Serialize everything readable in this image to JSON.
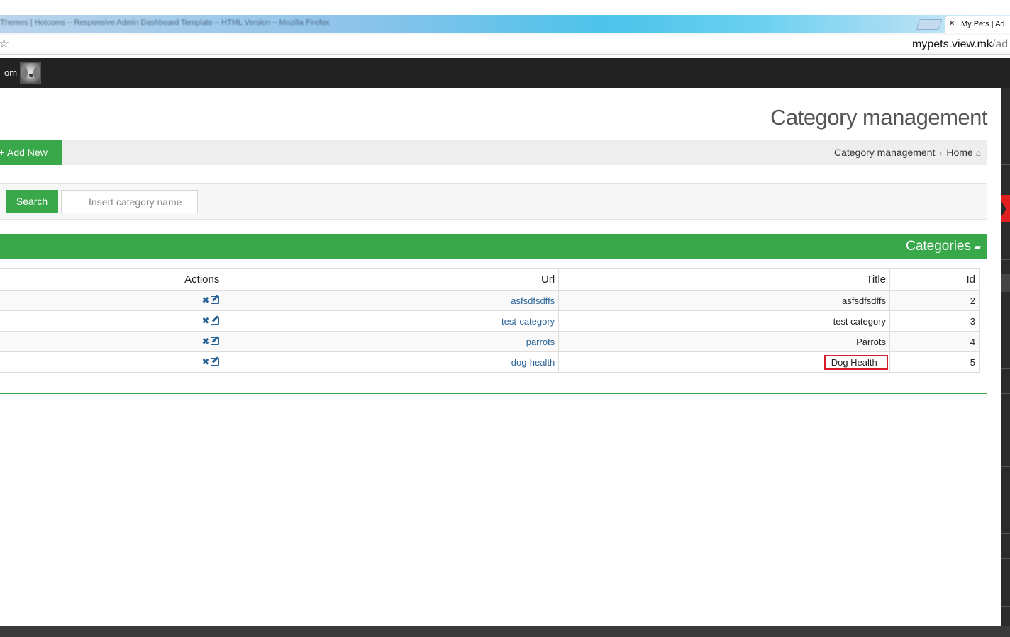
{
  "browser": {
    "window_title": "Themes | Hotcoms – Responsive Admin Dashboard Template – HTML Version – Mozilla Firefox",
    "tab_title": "My Pets | Ad",
    "tab_close": "×",
    "star_glyph": "☆",
    "url_host": "mypets.view.mk",
    "url_path": "/ad"
  },
  "navbar": {
    "user_text": "om",
    "avatar_icon": "dog-avatar"
  },
  "page": {
    "title": "Category management",
    "add_button": {
      "plus": "+",
      "label": "Add New"
    },
    "breadcrumb": {
      "current": "Category management",
      "separator": "‹",
      "home": "Home",
      "home_icon_glyph": "⌂"
    },
    "search": {
      "button_label": "Search",
      "placeholder": "Insert category name",
      "value": ""
    },
    "categories_panel": {
      "title": "Categories",
      "folder_icon_glyph": "▰",
      "columns": {
        "actions": "Actions",
        "url": "Url",
        "title": "Title",
        "id": "Id"
      },
      "rows": [
        {
          "url": "asfsdfsdffs",
          "title": "asfsdfsdffs",
          "id": "2"
        },
        {
          "url": "test-category",
          "title": "test category",
          "id": "3"
        },
        {
          "url": "parrots",
          "title": "Parrots",
          "id": "4"
        },
        {
          "url": "dog-health",
          "title": "Dog Health --",
          "id": "5"
        }
      ],
      "delete_glyph": "✖"
    }
  },
  "colors": {
    "primary_green": "#39a84a",
    "navbar_dark": "#222222",
    "link_blue": "#2a6496",
    "highlight_red": "#d41f2b"
  }
}
